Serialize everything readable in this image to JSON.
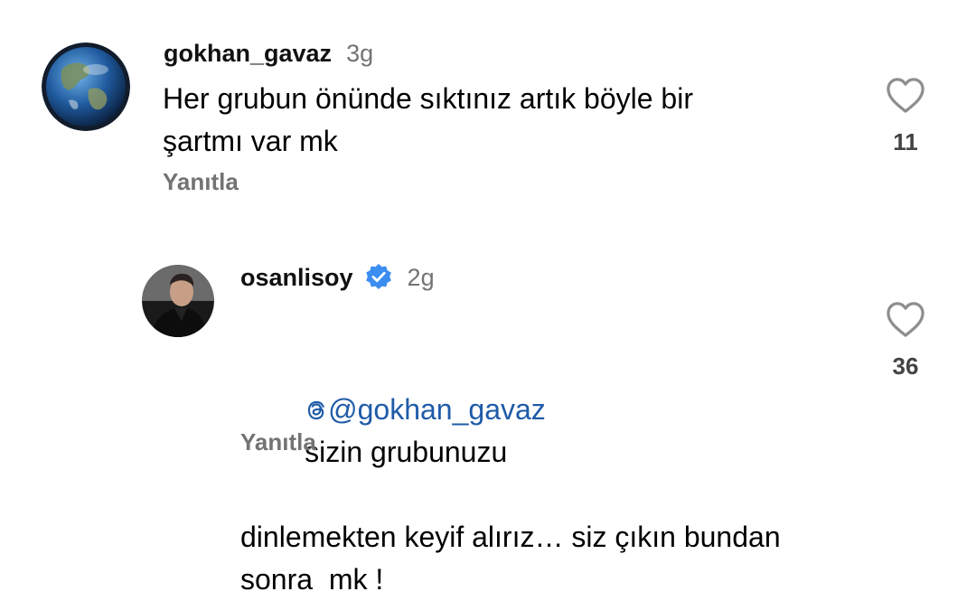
{
  "comments": [
    {
      "username": "gokhan_gavaz",
      "time": "3g",
      "text_lines": [
        "Her grubun önünde sıktınız artık böyle bir",
        "şartmı var mk"
      ],
      "reply_label": "Yanıtla",
      "likes": "11",
      "avatar_icon": "earth-globe",
      "verified": false
    },
    {
      "username": "osanlisoy",
      "time": "2g",
      "mention": "@gokhan_gavaz",
      "text_lines": [
        "  sizin grubunuzu",
        "dinlemekten keyif alırız… siz çıkın bundan",
        "sonra  mk !"
      ],
      "reply_label": "Yanıtla",
      "likes": "36",
      "avatar_icon": "person-photo",
      "verified": true,
      "verified_icon": "verified-badge-icon"
    }
  ],
  "colors": {
    "mention": "#1f5ba8",
    "meta": "#737373",
    "verified": "#3b8df0"
  }
}
